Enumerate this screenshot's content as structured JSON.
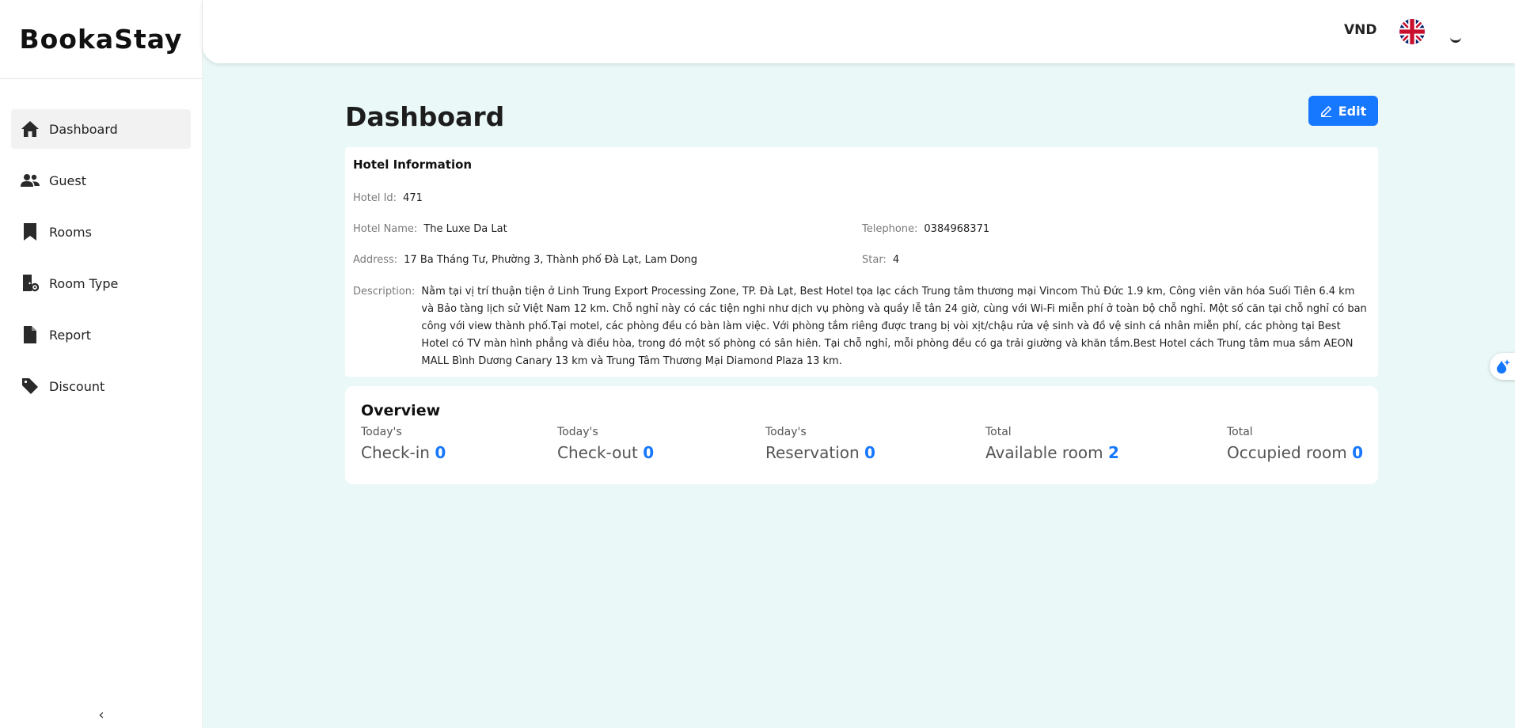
{
  "app": {
    "logo": "BookaStay"
  },
  "sidebar": {
    "items": [
      {
        "label": "Dashboard",
        "icon": "home-icon"
      },
      {
        "label": "Guest",
        "icon": "users-icon"
      },
      {
        "label": "Rooms",
        "icon": "bookmark-icon"
      },
      {
        "label": "Room Type",
        "icon": "door-settings-icon"
      },
      {
        "label": "Report",
        "icon": "file-icon"
      },
      {
        "label": "Discount",
        "icon": "tag-icon"
      }
    ],
    "active": "Dashboard",
    "collapse_glyph": "‹"
  },
  "header": {
    "currency": "VND",
    "language_flag": "uk-flag-icon"
  },
  "page": {
    "title": "Dashboard",
    "edit_label": "Edit"
  },
  "hotel_info": {
    "title": "Hotel Information",
    "id_label": "Hotel Id:",
    "id": "471",
    "name_label": "Hotel Name:",
    "name": "The Luxe Da Lat",
    "telephone_label": "Telephone:",
    "telephone": "0384968371",
    "address_label": "Address:",
    "address": "17 Ba Tháng Tư, Phường 3, Thành phố Đà Lạt, Lam Dong",
    "star_label": "Star:",
    "star": "4",
    "description_label": "Description:",
    "description": "Nằm tại vị trí thuận tiện ở Linh Trung Export Processing Zone, TP. Đà Lạt, Best Hotel tọa lạc cách Trung tâm thương mại Vincom Thủ Đức 1.9 km, Công viên văn hóa Suối Tiên 6.4 km và Bảo tàng lịch sử Việt Nam 12 km. Chỗ nghỉ này có các tiện nghi như dịch vụ phòng và quầy lễ tân 24 giờ, cùng với Wi-Fi miễn phí ở toàn bộ chỗ nghỉ. Một số căn tại chỗ nghỉ có ban công với view thành phố.Tại motel, các phòng đều có bàn làm việc. Với phòng tắm riêng được trang bị vòi xịt/chậu rửa vệ sinh và đồ vệ sinh cá nhân miễn phí, các phòng tại Best Hotel có TV màn hình phẳng và điều hòa, trong đó một số phòng có sân hiên. Tại chỗ nghỉ, mỗi phòng đều có ga trải giường và khăn tắm.Best Hotel cách Trung tâm mua sắm AEON MALL Bình Dương Canary 13 km và Trung Tâm Thương Mại Diamond Plaza 13 km."
  },
  "overview": {
    "title": "Overview",
    "stats": [
      {
        "caption": "Today's",
        "label": "Check-in",
        "value": "0"
      },
      {
        "caption": "Today's",
        "label": "Check-out",
        "value": "0"
      },
      {
        "caption": "Today's",
        "label": "Reservation",
        "value": "0"
      },
      {
        "caption": "Total",
        "label": "Available room",
        "value": "2"
      },
      {
        "caption": "Total",
        "label": "Occupied room",
        "value": "0"
      }
    ]
  },
  "colors": {
    "primary": "#1677ff",
    "background": "#eaf8f8"
  }
}
